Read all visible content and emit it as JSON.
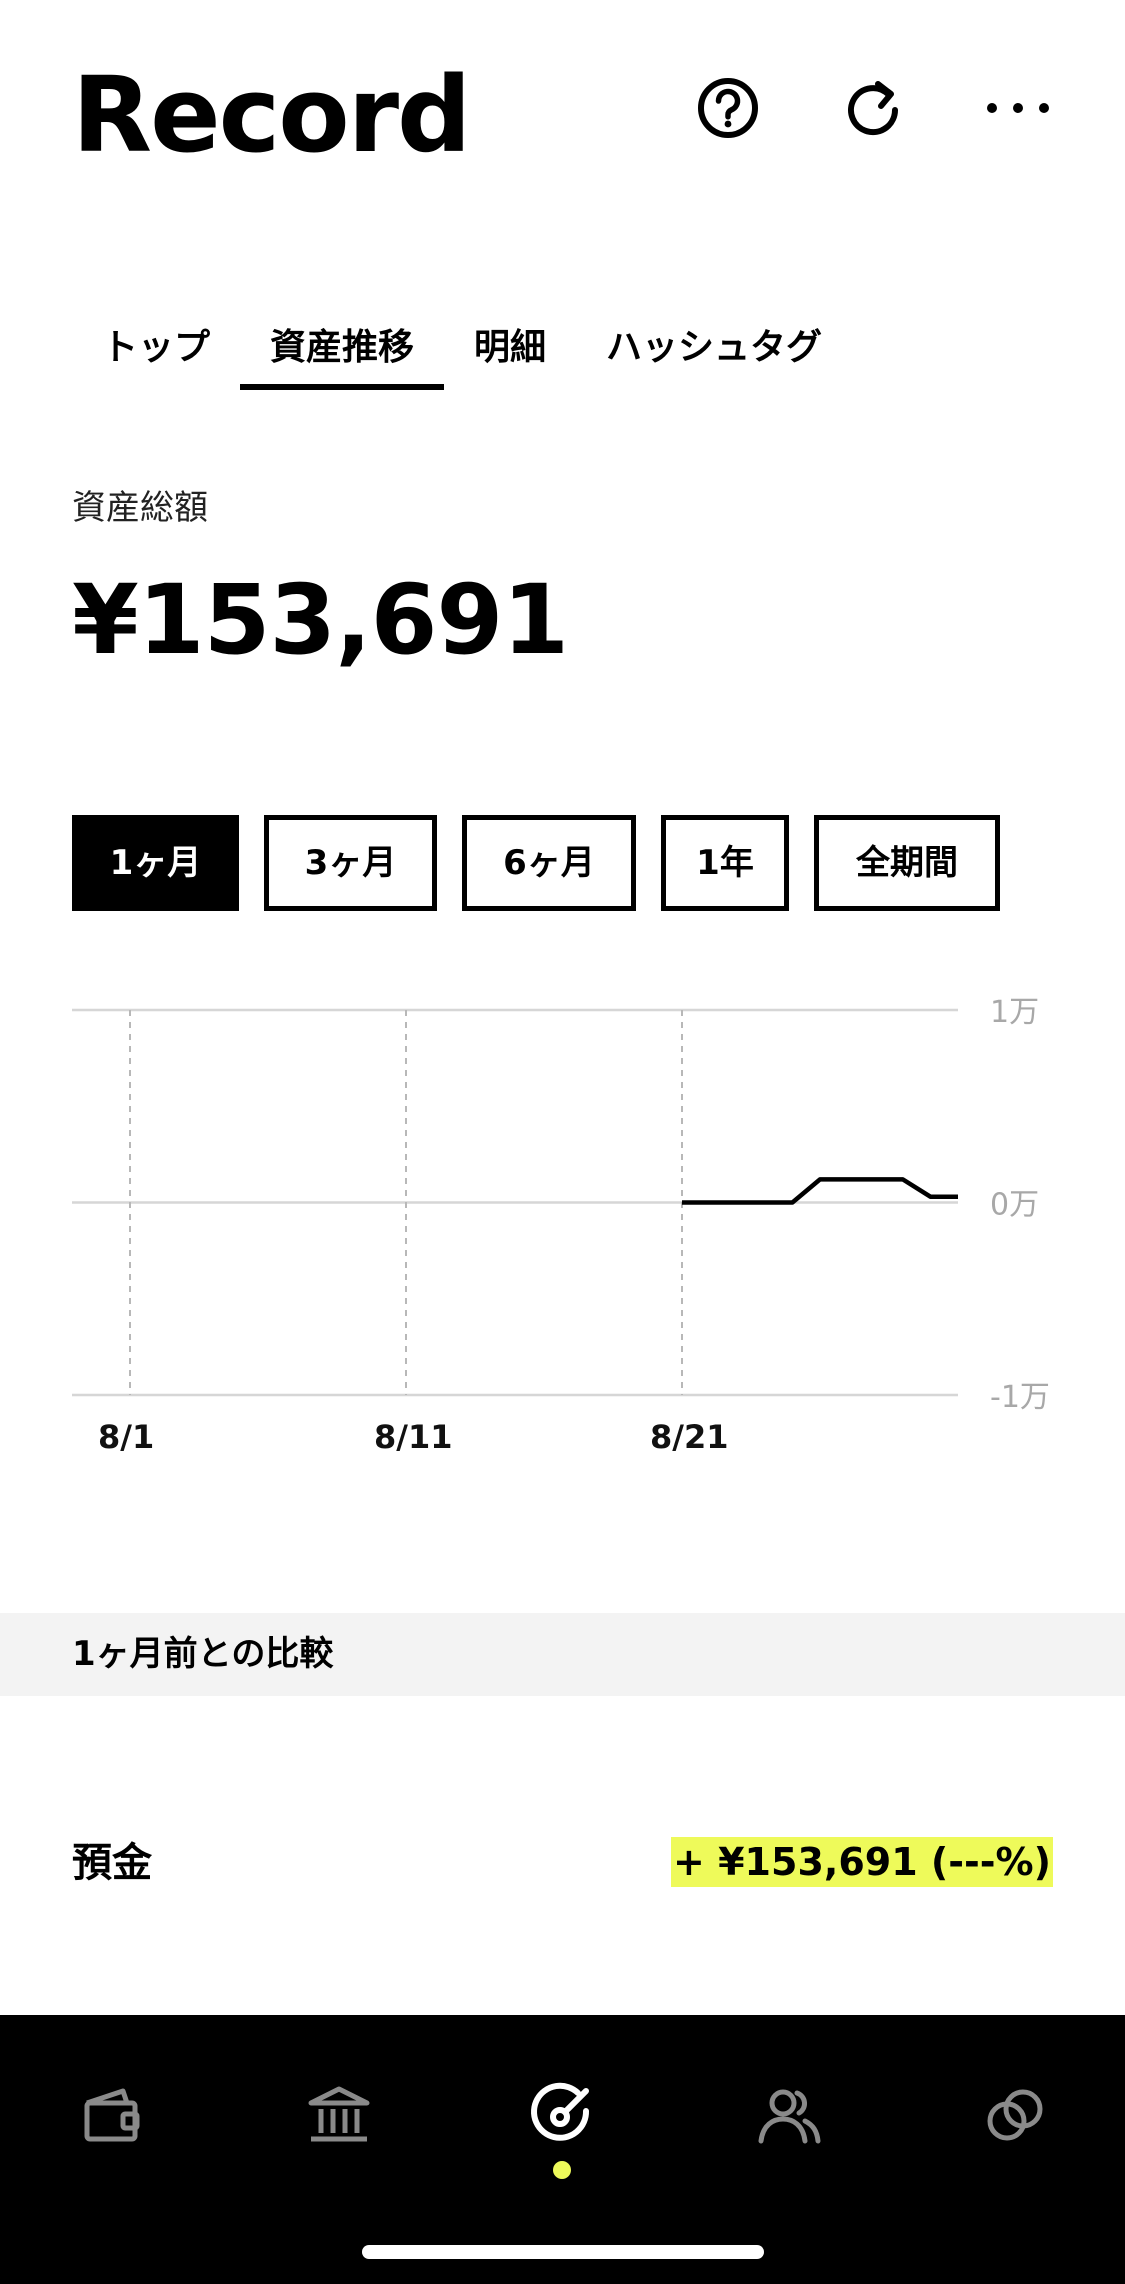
{
  "header": {
    "title": "Record",
    "icons": [
      "help-icon",
      "refresh-icon",
      "more-icon"
    ]
  },
  "tabs": [
    {
      "label": "トップ",
      "active": false
    },
    {
      "label": "資産推移",
      "active": true
    },
    {
      "label": "明細",
      "active": false
    },
    {
      "label": "ハッシュタグ",
      "active": false
    }
  ],
  "summary": {
    "label": "資産総額",
    "value": "¥153,691"
  },
  "periods": [
    {
      "label": "1ヶ月",
      "active": true
    },
    {
      "label": "3ヶ月",
      "active": false
    },
    {
      "label": "6ヶ月",
      "active": false
    },
    {
      "label": "1年",
      "active": false
    },
    {
      "label": "全期間",
      "active": false
    }
  ],
  "chart_data": {
    "type": "line",
    "y_tick_labels": [
      "1万",
      "0万",
      "-1万"
    ],
    "x_tick_labels": [
      "8/1",
      "8/11",
      "8/21"
    ],
    "ylim": [
      -1,
      1
    ],
    "y_unit": "万",
    "grid": true,
    "line_color": "#000000",
    "x": [
      "8/21",
      "8/22",
      "8/23",
      "8/24",
      "8/25",
      "8/26",
      "8/27",
      "8/28",
      "8/29",
      "8/30",
      "8/31"
    ],
    "values": [
      0.0,
      0.0,
      0.0,
      0.0,
      0.0,
      0.12,
      0.12,
      0.12,
      0.12,
      0.03,
      0.03
    ]
  },
  "comparison": {
    "title": "1ヶ月前との比較",
    "rows": [
      {
        "label": "預金",
        "value": "+ ¥153,691 (---%)"
      }
    ]
  },
  "bottom_nav": {
    "items": [
      {
        "icon": "wallet-icon",
        "active": false
      },
      {
        "icon": "bank-icon",
        "active": false
      },
      {
        "icon": "record-icon",
        "active": true
      },
      {
        "icon": "users-icon",
        "active": false
      },
      {
        "icon": "link-icon",
        "active": false
      }
    ],
    "accent": "#eefa5a"
  }
}
